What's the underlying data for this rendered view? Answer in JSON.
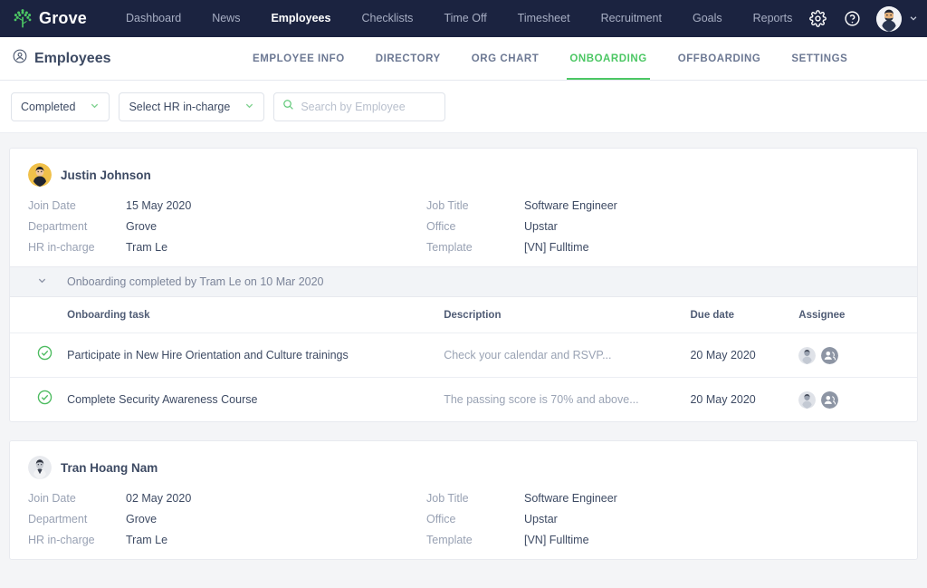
{
  "brand": {
    "name": "Grove",
    "logo_icon": "grove-tree-logo",
    "accent": "#4cc764"
  },
  "topnav": {
    "items": [
      {
        "label": "Dashboard",
        "active": false
      },
      {
        "label": "News",
        "active": false
      },
      {
        "label": "Employees",
        "active": true
      },
      {
        "label": "Checklists",
        "active": false
      },
      {
        "label": "Time Off",
        "active": false
      },
      {
        "label": "Timesheet",
        "active": false
      },
      {
        "label": "Recruitment",
        "active": false
      },
      {
        "label": "Goals",
        "active": false
      },
      {
        "label": "Reports",
        "active": false
      }
    ],
    "settings_icon": "gear-icon",
    "help_icon": "question-circle-icon",
    "account_icon": "user-avatar",
    "account_chevron": "chevron-down-icon"
  },
  "subheader": {
    "title": "Employees",
    "title_icon": "user-circle-icon",
    "tabs": [
      {
        "label": "EMPLOYEE INFO",
        "active": false
      },
      {
        "label": "DIRECTORY",
        "active": false
      },
      {
        "label": "ORG CHART",
        "active": false
      },
      {
        "label": "ONBOARDING",
        "active": true
      },
      {
        "label": "OFFBOARDING",
        "active": false
      },
      {
        "label": "SETTINGS",
        "active": false
      }
    ]
  },
  "filters": {
    "status": {
      "value": "Completed",
      "chevron": "chevron-down-icon"
    },
    "hr": {
      "value": "Select HR in-charge",
      "chevron": "chevron-down-icon"
    },
    "search": {
      "value": "",
      "placeholder": "Search by Employee",
      "icon": "search-icon"
    }
  },
  "labels": {
    "join_date": "Join Date",
    "department": "Department",
    "hr_in_charge": "HR in-charge",
    "job_title": "Job Title",
    "office": "Office",
    "template": "Template"
  },
  "table_headers": {
    "task": "Onboarding task",
    "description": "Description",
    "due_date": "Due date",
    "assignee": "Assignee"
  },
  "employees": [
    {
      "name": "Justin Johnson",
      "avatar": "avatar-justin-johnson",
      "join_date": "15 May 2020",
      "department": "Grove",
      "hr_in_charge": "Tram Le",
      "job_title": "Software Engineer",
      "office": "Upstar",
      "template": "[VN] Fulltime",
      "completed_note": "Onboarding completed by Tram Le on 10 Mar 2020",
      "collapse_icon": "chevron-down-icon",
      "tasks": [
        {
          "status_icon": "check-circle-icon",
          "name": "Participate in New Hire Orientation and Culture trainings",
          "description": "Check your calendar and RSVP...",
          "due_date": "20 May 2020",
          "assignees": [
            "avatar-photo",
            "avatar-group"
          ]
        },
        {
          "status_icon": "check-circle-icon",
          "name": "Complete Security Awareness Course",
          "description": "The passing score is 70% and above...",
          "due_date": "20 May 2020",
          "assignees": [
            "avatar-photo",
            "avatar-group"
          ]
        }
      ]
    },
    {
      "name": "Tran Hoang Nam",
      "avatar": "avatar-tran-hoang-nam",
      "join_date": "02 May 2020",
      "department": "Grove",
      "hr_in_charge": "Tram Le",
      "job_title": "Software Engineer",
      "office": "Upstar",
      "template": "[VN] Fulltime"
    }
  ]
}
